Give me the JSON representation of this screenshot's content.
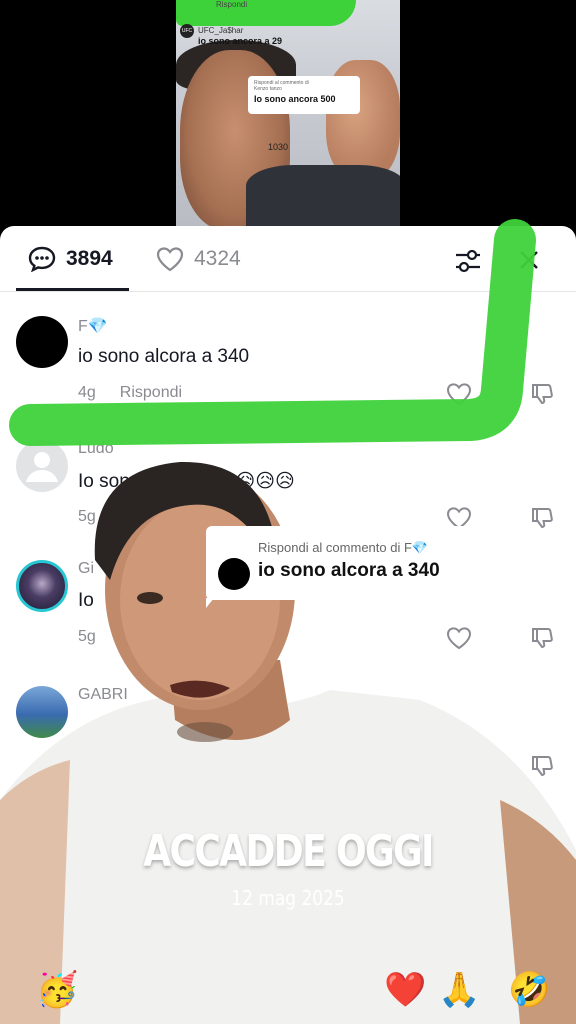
{
  "top_video": {
    "overlay_label": "Rispondi",
    "username": "UFC_Ja$har",
    "logo_text": "UFC",
    "subtitle": "io sono ancora a 29",
    "bubble_label": "Rispondi al commento di",
    "bubble_user": "Kenzo tanzo",
    "bubble_text": "Io sono ancora 500",
    "number": "1030"
  },
  "tabs": {
    "comments_count": "3894",
    "likes_count": "4324"
  },
  "comments": [
    {
      "user": "F💎",
      "text": "io sono alcora a 340",
      "time": "4g",
      "reply": "Rispondi"
    },
    {
      "user": "Ludo",
      "text": "Io sono ancora a 5😥😥😥",
      "time": "5g",
      "reply": ""
    },
    {
      "user": "Gi",
      "text": "Io",
      "time": "5g",
      "reply": ""
    },
    {
      "user": "GABRI",
      "text": "",
      "time": "",
      "reply": ""
    }
  ],
  "reply_card": {
    "label": "Rispondi al commento di F💎",
    "text": "io sono alcora a 340"
  },
  "overlay": {
    "title": "ACCADDE OGGI",
    "date": "12 mag 2025"
  },
  "emojis": [
    "🥳",
    "❤️",
    "🙏",
    "🤣"
  ],
  "colors": {
    "annotation_green": "#3ed23a",
    "text_primary": "#161823",
    "text_secondary": "#8a8b91"
  }
}
